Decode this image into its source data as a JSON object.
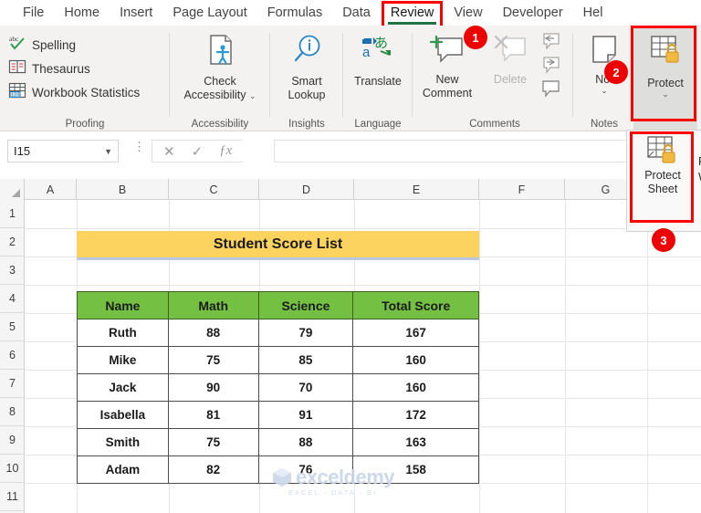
{
  "ribbon": {
    "tabs": [
      {
        "label": "File",
        "active": false
      },
      {
        "label": "Home",
        "active": false
      },
      {
        "label": "Insert",
        "active": false
      },
      {
        "label": "Page Layout",
        "active": false
      },
      {
        "label": "Formulas",
        "active": false
      },
      {
        "label": "Data",
        "active": false
      },
      {
        "label": "Review",
        "active": true
      },
      {
        "label": "View",
        "active": false
      },
      {
        "label": "Developer",
        "active": false
      },
      {
        "label": "Hel",
        "active": false
      }
    ],
    "groups": {
      "proofing": {
        "label": "Proofing"
      },
      "accessibility": {
        "label": "Accessibility"
      },
      "insights": {
        "label": "Insights"
      },
      "language": {
        "label": "Language"
      },
      "comments": {
        "label": "Comments"
      },
      "notes": {
        "label": "Notes"
      },
      "protect": {
        "label": ""
      }
    },
    "commands": {
      "spelling": "Spelling",
      "thesaurus": "Thesaurus",
      "workbook_statistics": "Workbook Statistics",
      "check_accessibility": "Check\nAccessibility",
      "check_accessibility_l1": "Check",
      "check_accessibility_l2": "Accessibility",
      "smart_lookup_l1": "Smart",
      "smart_lookup_l2": "Lookup",
      "translate": "Translate",
      "new_comment_l1": "New",
      "new_comment_l2": "Comment",
      "delete": "Delete",
      "notes": "Not",
      "protect": "Protect",
      "protect_sheet_l1": "Protect",
      "protect_sheet_l2": "Sheet",
      "protect_workbook_l1": "P",
      "protect_workbook_l2": "W"
    }
  },
  "callouts": {
    "badge1": "1",
    "badge2": "2",
    "badge3": "3",
    "accent_red": "#ff0000",
    "badge_red": "#ee0000"
  },
  "formula_bar": {
    "name_box_value": "I15",
    "cancel_icon": "✕",
    "enter_icon": "✓",
    "function_icon": "ƒx",
    "formula_value": ""
  },
  "grid": {
    "columns": [
      "A",
      "B",
      "C",
      "D",
      "E",
      "F",
      "G"
    ],
    "rows": [
      "1",
      "2",
      "3",
      "4",
      "5",
      "6",
      "7",
      "8",
      "9",
      "10",
      "11"
    ]
  },
  "sheet": {
    "title": "Student Score List",
    "title_bg": "#fcd35f",
    "header_bg": "#74c043",
    "table": {
      "headers": [
        "Name",
        "Math",
        "Science",
        "Total Score"
      ],
      "rows": [
        [
          "Ruth",
          "88",
          "79",
          "167"
        ],
        [
          "Mike",
          "75",
          "85",
          "160"
        ],
        [
          "Jack",
          "90",
          "70",
          "160"
        ],
        [
          "Isabella",
          "81",
          "91",
          "172"
        ],
        [
          "Smith",
          "75",
          "88",
          "163"
        ],
        [
          "Adam",
          "82",
          "76",
          "158"
        ]
      ]
    }
  },
  "watermark": {
    "text": "exceldemy",
    "subtext": "EXCEL - DATA - BI"
  }
}
